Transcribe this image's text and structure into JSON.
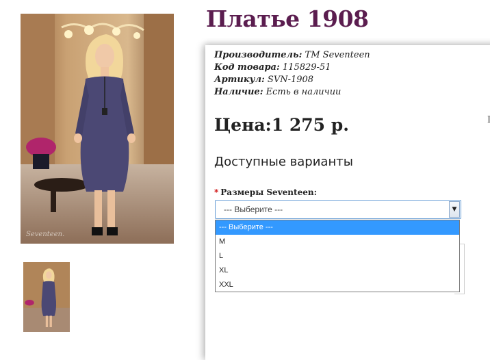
{
  "product": {
    "title": "Платье 1908",
    "manufacturer_label": "Производитель:",
    "manufacturer_value": " ТМ Seventeen",
    "code_label": "Код товара:",
    "code_value": " 115829-51",
    "article_label": "Артикул:",
    "article_value": " SVN-1908",
    "availability_label": "Наличие:",
    "availability_value": " Есть в наличии",
    "price": "Цена:1 275 р.",
    "right_mark": "I"
  },
  "options": {
    "heading": "Доступные варианты",
    "required_mark": "*",
    "size_label": "Размеры Seventeen:",
    "selected": "--- Выберите ---",
    "dropdown_items": [
      "--- Выберите ---",
      "M",
      "L",
      "XL",
      "XXL"
    ]
  },
  "colors": {
    "title": "#5b1d4f",
    "dress": "#4b4874",
    "selection": "#3399ff",
    "required": "#cc0000"
  },
  "watermark": "Seventeen"
}
